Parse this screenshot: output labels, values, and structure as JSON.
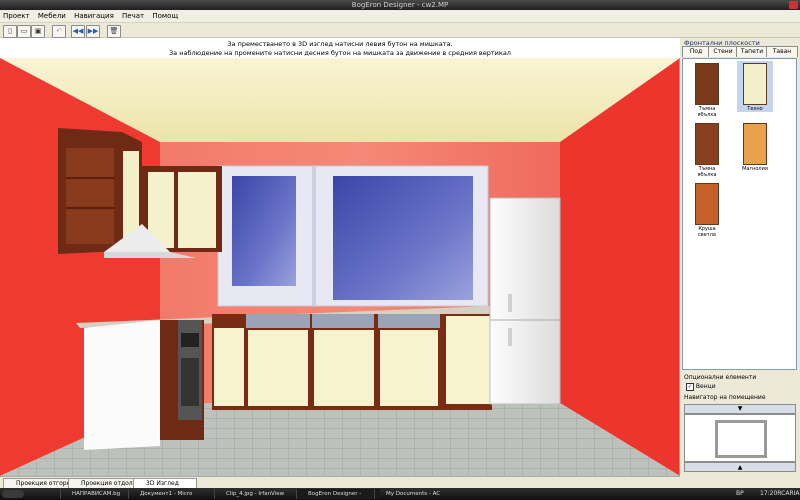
{
  "window": {
    "title": "BogEron Designer - cw2.MP"
  },
  "menu": [
    "Проект",
    "Мебели",
    "Навигация",
    "Печат",
    "Помощ"
  ],
  "toolbar": {
    "buttons": [
      {
        "name": "new-icon",
        "glyph": "▯"
      },
      {
        "name": "open-icon",
        "glyph": "▭"
      },
      {
        "name": "save-icon",
        "glyph": "▣"
      },
      {
        "name": "undo-icon",
        "glyph": "↶"
      },
      {
        "name": "rewind-icon",
        "glyph": "◀◀"
      },
      {
        "name": "forward-icon",
        "glyph": "▶▶"
      },
      {
        "name": "trash-icon",
        "glyph": "🗑"
      }
    ]
  },
  "hint": {
    "line1": "За преместването в 3D изглед натисни левия бутон на мишката.",
    "line2": "За наблюдение на промените натисни десния бутон на мишката за движение в средния вертикал"
  },
  "right_panel": {
    "title": "Фронтални плоскости",
    "tabs": [
      "Под",
      "Стени",
      "Тапети",
      "Таван"
    ],
    "thumbnails": [
      {
        "label": "Тъмна ябълка",
        "color": "#7a3a1c",
        "selected": false
      },
      {
        "label": "Техно",
        "color": "#f3efc8",
        "selected": true
      },
      {
        "label": "Тъмна ябълка",
        "color": "#8a3f1e",
        "selected": false
      },
      {
        "label": "Магнолия",
        "color": "#e9a24b",
        "selected": false
      },
      {
        "label": "Круша светла",
        "color": "#c5602a",
        "selected": false
      }
    ],
    "options_title": "Опционални елементи",
    "options_checkbox": "Венци",
    "navigator_title": "Навигатор на помещение",
    "nav_up": "▲",
    "nav_down": "▲"
  },
  "bottom_tabs": [
    "Проекция отгоре",
    "Проекция отдолу",
    "3D Изглед"
  ],
  "taskbar": {
    "items": [
      "НАПРАВИСАМ.bg",
      "Документ1 - Micro",
      "Clip_4.jpg - IrfanView",
      "BogEron Designer -",
      "My Documents - AC"
    ],
    "lang": "BP",
    "clock": "17:20RCARIA"
  },
  "colors": {
    "wall": "#f03c33",
    "floor": "#b9bdb7",
    "ceiling": "#f6f0c4",
    "cabinet_front": "#f7f3cf",
    "cabinet_frame": "#7a2b14"
  }
}
